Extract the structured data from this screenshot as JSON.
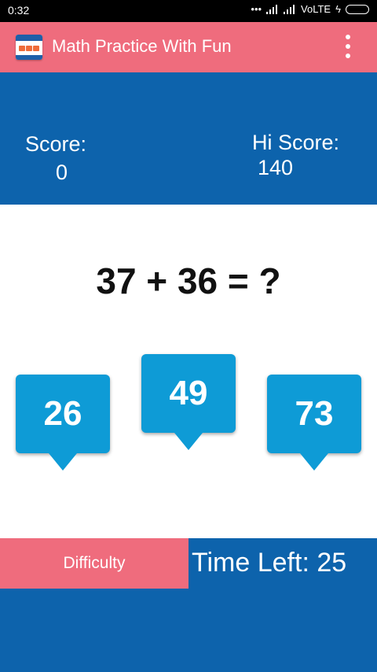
{
  "status_bar": {
    "time": "0:32",
    "network": "VoLTE"
  },
  "app_bar": {
    "title": "Math Practice With Fun",
    "icon": "app-logo-icon",
    "menu_icon": "overflow-menu-icon"
  },
  "scores": {
    "score_label": "Score:",
    "score_value": "0",
    "hiscore_label": "Hi Score:",
    "hiscore_value": "140"
  },
  "question": {
    "text": "37 + 36 = ?"
  },
  "answers": [
    {
      "label": "26"
    },
    {
      "label": "49"
    },
    {
      "label": "73"
    }
  ],
  "footer": {
    "difficulty_label": "Difficulty",
    "time_left": "Time Left: 25"
  },
  "colors": {
    "primary_blue": "#0d63ac",
    "accent_pink": "#ef6c7d",
    "answer_blue": "#0e9bd6"
  }
}
